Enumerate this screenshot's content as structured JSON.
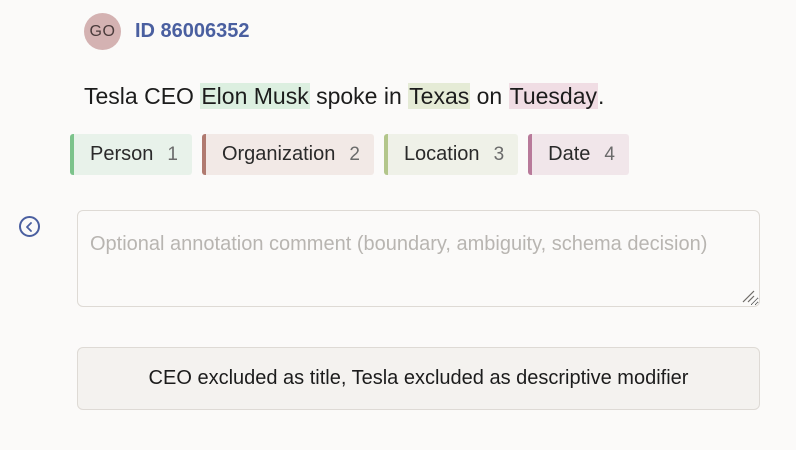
{
  "header": {
    "avatar_initials": "GO",
    "task_id": "ID 86006352"
  },
  "sentence": {
    "segments": [
      {
        "text": "Tesla CEO ",
        "entity": null
      },
      {
        "text": "Elon Musk",
        "entity": "person"
      },
      {
        "text": " spoke in ",
        "entity": null
      },
      {
        "text": "Texas",
        "entity": "location"
      },
      {
        "text": " on ",
        "entity": null
      },
      {
        "text": "Tuesday",
        "entity": "date"
      },
      {
        "text": ".",
        "entity": null
      }
    ]
  },
  "labels": [
    {
      "id": "person",
      "name": "Person",
      "key": "1",
      "accent": "#7cc38b",
      "bg": "#e8f2ea",
      "highlight": "#dcefe0"
    },
    {
      "id": "organization",
      "name": "Organization",
      "key": "2",
      "accent": "#b07a70",
      "bg": "#f2e9e6",
      "highlight": "#eddcd7"
    },
    {
      "id": "location",
      "name": "Location",
      "key": "3",
      "accent": "#b3c68b",
      "bg": "#eff1e8",
      "highlight": "#e5ebd6"
    },
    {
      "id": "date",
      "name": "Date",
      "key": "4",
      "accent": "#b87a9a",
      "bg": "#f1e6ea",
      "highlight": "#f0dde4"
    }
  ],
  "comment": {
    "placeholder": "Optional annotation comment (boundary, ambiguity, schema decision)",
    "value": ""
  },
  "note": {
    "text": "CEO excluded as title, Tesla excluded as descriptive modifier"
  },
  "icons": {
    "back": "chevron-left-circle-icon",
    "resize": "resize-handle-icon"
  },
  "colors": {
    "accent": "#4a5fa0",
    "avatar_bg": "#d4b2b2"
  }
}
